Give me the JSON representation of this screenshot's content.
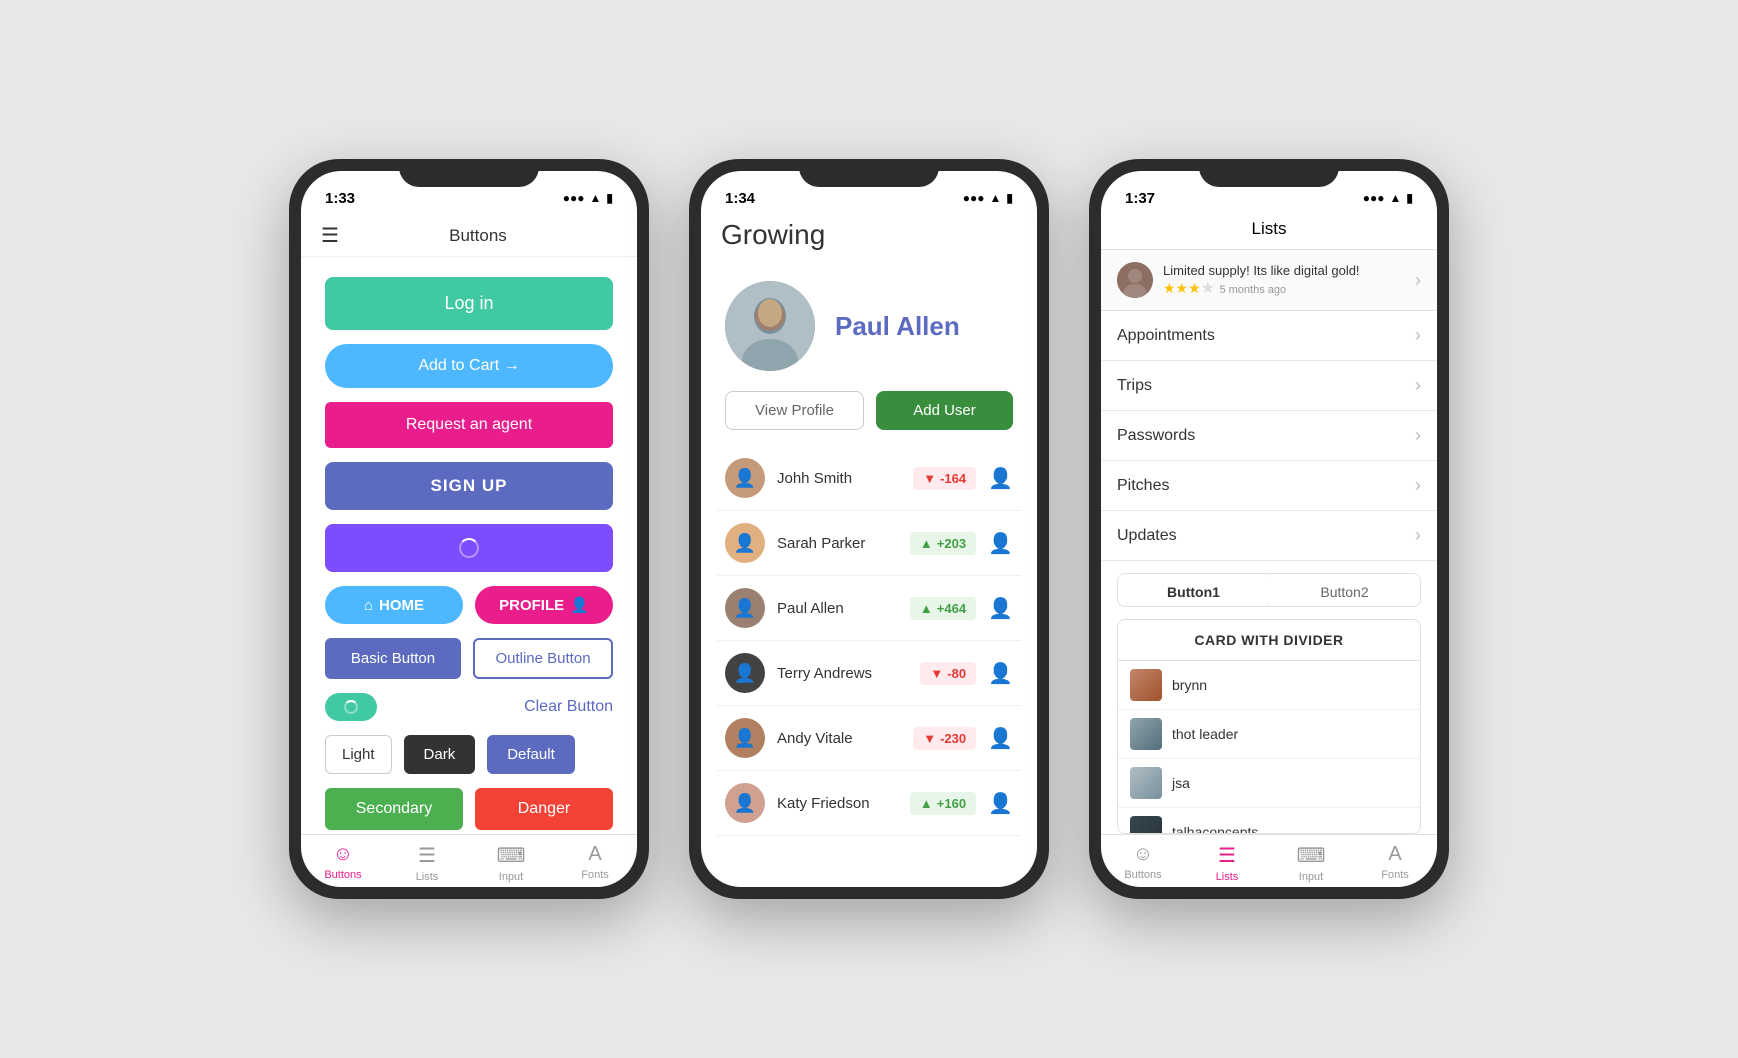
{
  "phone1": {
    "status": {
      "time": "1:33",
      "signal": "...",
      "wifi": "wifi",
      "battery": "battery"
    },
    "header": {
      "title": "Buttons"
    },
    "buttons": {
      "login": "Log in",
      "addToCart": "Add to Cart →",
      "request": "Request an agent",
      "signup": "SIGN UP",
      "home": "HOME",
      "profile": "PROFILE",
      "basic": "Basic Button",
      "outline": "Outline Button",
      "clear": "Clear Button",
      "light": "Light",
      "dark": "Dark",
      "default": "Default",
      "secondary": "Secondary",
      "danger": "Danger"
    },
    "tabs": {
      "buttons": "Buttons",
      "lists": "Lists",
      "input": "Input",
      "fonts": "Fonts"
    }
  },
  "phone2": {
    "status": {
      "time": "1:34"
    },
    "header": {
      "appTitle": "Growing"
    },
    "profile": {
      "name": "Paul Allen"
    },
    "actions": {
      "viewProfile": "View Profile",
      "addUser": "Add User"
    },
    "users": [
      {
        "name": "Johh Smith",
        "score": "-164",
        "type": "negative"
      },
      {
        "name": "Sarah Parker",
        "score": "+203",
        "type": "positive"
      },
      {
        "name": "Paul Allen",
        "score": "+464",
        "type": "positive"
      },
      {
        "name": "Terry Andrews",
        "score": "-80",
        "type": "negative"
      },
      {
        "name": "Andy Vitale",
        "score": "-230",
        "type": "negative"
      },
      {
        "name": "Katy Friedson",
        "score": "+160",
        "type": "positive"
      }
    ]
  },
  "phone3": {
    "status": {
      "time": "1:37"
    },
    "header": {
      "title": "Lists"
    },
    "review": {
      "text": "Limited supply! Its like digital gold!",
      "age": "5 months ago",
      "stars": 3.5
    },
    "menuItems": [
      "Appointments",
      "Trips",
      "Passwords",
      "Pitches",
      "Updates"
    ],
    "segmented": {
      "button1": "Button1",
      "button2": "Button2"
    },
    "card": {
      "title": "CARD WITH DIVIDER",
      "items": [
        "brynn",
        "thot leader",
        "jsa",
        "talhaconcepts"
      ]
    },
    "tabs": {
      "buttons": "Buttons",
      "lists": "Lists",
      "input": "Input",
      "fonts": "Fonts"
    }
  }
}
